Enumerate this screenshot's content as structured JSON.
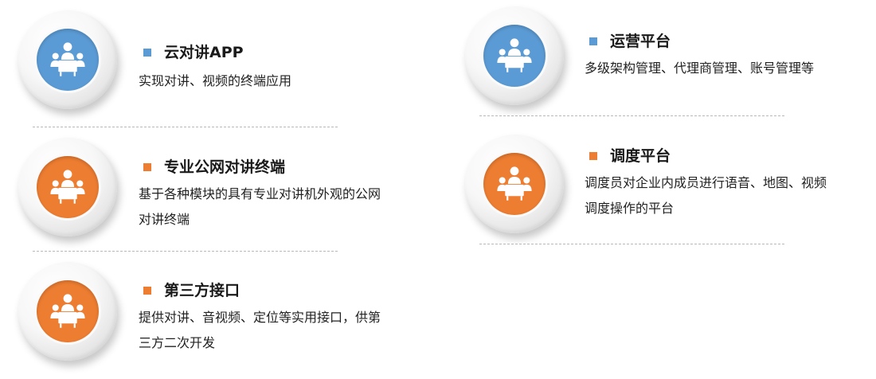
{
  "colors": {
    "blue": "#5b9bd5",
    "orange": "#ed7d31"
  },
  "icon_name": "meeting-people-icon",
  "items": [
    {
      "title": "云对讲APP",
      "desc_lines": [
        "实现对讲、视频的终端应用"
      ],
      "color": "#5b9bd5"
    },
    {
      "title": "专业公网对讲终端",
      "desc_lines": [
        "基于各种模块的具有专业对讲机外观的公网",
        "对讲终端"
      ],
      "color": "#ed7d31"
    },
    {
      "title": "第三方接口",
      "desc_lines": [
        "提供对讲、音视频、定位等实用接口，供第",
        "三方二次开发"
      ],
      "color": "#ed7d31"
    },
    {
      "title": "运营平台",
      "desc_lines": [
        "多级架构管理、代理商管理、账号管理等"
      ],
      "color": "#5b9bd5"
    },
    {
      "title": "调度平台",
      "desc_lines": [
        "调度员对企业内成员进行语音、地图、视频",
        "调度操作的平台"
      ],
      "color": "#ed7d31"
    }
  ]
}
